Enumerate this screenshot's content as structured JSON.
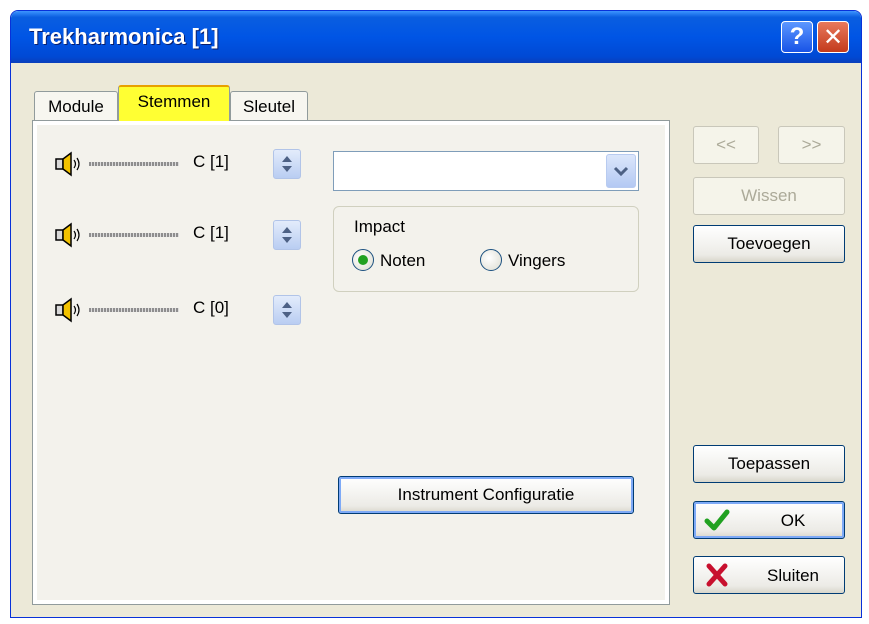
{
  "window": {
    "title": "Trekharmonica [1]",
    "help_label": "?",
    "close_label": "✕"
  },
  "tabs": [
    {
      "label": "Module",
      "active": false
    },
    {
      "label": "Stemmen",
      "active": true
    },
    {
      "label": "Sleutel",
      "active": false
    }
  ],
  "voices": [
    {
      "label": "C [1]"
    },
    {
      "label": "C [1]"
    },
    {
      "label": "C [0]"
    }
  ],
  "dropdown": {
    "value": ""
  },
  "impact": {
    "title": "Impact",
    "options": [
      {
        "label": "Noten",
        "selected": true
      },
      {
        "label": "Vingers",
        "selected": false
      }
    ]
  },
  "buttons": {
    "prev": "<<",
    "next": ">>",
    "clear": "Wissen",
    "add": "Toevoegen",
    "instrument_config": "Instrument Configuratie",
    "apply": "Toepassen",
    "ok": "OK",
    "close": "Sluiten"
  },
  "colors": {
    "active_tab": "#ffff33",
    "titlebar": "#0055e5",
    "ok_check": "#21a121",
    "close_x": "#c8102e"
  },
  "icons": [
    "speaker-icon",
    "spinner-icon",
    "chevron-down-icon",
    "checkmark-icon",
    "x-icon",
    "help-icon",
    "close-icon"
  ]
}
